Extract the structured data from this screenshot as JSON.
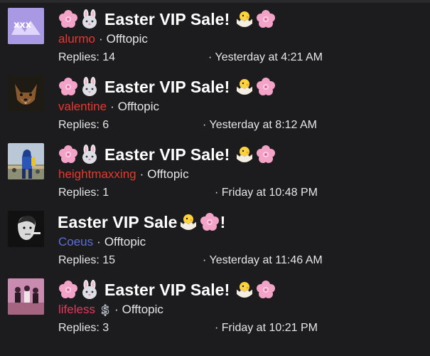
{
  "threads": [
    {
      "title": "Easter VIP Sale!",
      "author": "alurmo",
      "author_color": "#e8382f",
      "forum": "Offtopic",
      "replies": "Replies: 14",
      "last_post": "Yesterday at 4:21 AM",
      "emoji_before": [
        "cherry-blossom-icon",
        "rabbit-face-icon"
      ],
      "emoji_after": [
        "hatching-chick-icon",
        "cherry-blossom-icon"
      ]
    },
    {
      "title": "Easter VIP Sale!",
      "author": "valentine",
      "author_color": "#e8382f",
      "forum": "Offtopic",
      "replies": "Replies: 6",
      "last_post": "Yesterday at 8:12 AM",
      "emoji_before": [
        "cherry-blossom-icon",
        "rabbit-face-icon"
      ],
      "emoji_after": [
        "hatching-chick-icon",
        "cherry-blossom-icon"
      ]
    },
    {
      "title": "Easter VIP Sale!",
      "author": "heightmaxxing",
      "author_color": "#e8382f",
      "forum": "Offtopic",
      "replies": "Replies: 1",
      "last_post": "Friday at 10:48 PM",
      "emoji_before": [
        "cherry-blossom-icon",
        "rabbit-face-icon"
      ],
      "emoji_after": [
        "hatching-chick-icon",
        "cherry-blossom-icon"
      ]
    },
    {
      "title": "Easter VIP Sale",
      "title_suffix": "!",
      "author": "Coeus",
      "author_color": "#5b6fd6",
      "forum": "Offtopic",
      "replies": "Replies: 15",
      "last_post": "Yesterday at 11:46 AM",
      "emoji_before": [],
      "emoji_after": [
        "hatching-chick-icon",
        "cherry-blossom-icon"
      ]
    },
    {
      "title": "Easter VIP Sale!",
      "author": "lifeless",
      "author_color": "#e8365c",
      "author_badge": "dollar-badge-icon",
      "forum": "Offtopic",
      "replies": "Replies: 3",
      "last_post": "Friday at 10:21 PM",
      "emoji_before": [
        "cherry-blossom-icon",
        "rabbit-face-icon"
      ],
      "emoji_after": [
        "hatching-chick-icon",
        "cherry-blossom-icon"
      ]
    }
  ],
  "separator": "·"
}
